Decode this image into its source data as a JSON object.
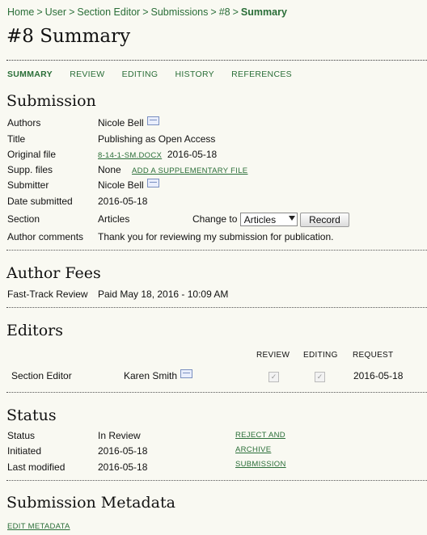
{
  "breadcrumb": {
    "items": [
      "Home",
      "User",
      "Section Editor",
      "Submissions",
      "#8"
    ],
    "current": "Summary",
    "separator": ">"
  },
  "page_title": "#8 Summary",
  "tabs": [
    {
      "label": "SUMMARY",
      "active": true
    },
    {
      "label": "REVIEW",
      "active": false
    },
    {
      "label": "EDITING",
      "active": false
    },
    {
      "label": "HISTORY",
      "active": false
    },
    {
      "label": "REFERENCES",
      "active": false
    }
  ],
  "submission": {
    "heading": "Submission",
    "authors_label": "Authors",
    "authors_value": "Nicole Bell",
    "title_label": "Title",
    "title_value": "Publishing as Open Access",
    "original_file_label": "Original file",
    "original_file_link": "8-14-1-SM.DOCX",
    "original_file_date": "2016-05-18",
    "supp_files_label": "Supp. files",
    "supp_files_value": "None",
    "add_supp_link": "ADD A SUPPLEMENTARY FILE",
    "submitter_label": "Submitter",
    "submitter_value": "Nicole Bell",
    "date_submitted_label": "Date submitted",
    "date_submitted_value": "2016-05-18",
    "section_label": "Section",
    "section_value": "Articles",
    "change_to_label": "Change to",
    "change_to_selected": "Articles",
    "record_button": "Record",
    "author_comments_label": "Author comments",
    "author_comments_value": "Thank you for reviewing my submission for publication."
  },
  "author_fees": {
    "heading": "Author Fees",
    "fast_track_label": "Fast-Track Review",
    "fast_track_value": "Paid May 18, 2016 - 10:09 AM"
  },
  "editors": {
    "heading": "Editors",
    "col_review": "REVIEW",
    "col_editing": "EDITING",
    "col_request": "REQUEST",
    "role": "Section Editor",
    "name": "Karen Smith",
    "request_date": "2016-05-18",
    "review_checked": true,
    "editing_checked": true
  },
  "status": {
    "heading": "Status",
    "status_label": "Status",
    "status_value": "In Review",
    "reject_link": "REJECT AND ARCHIVE SUBMISSION",
    "initiated_label": "Initiated",
    "initiated_value": "2016-05-18",
    "last_modified_label": "Last modified",
    "last_modified_value": "2016-05-18"
  },
  "metadata": {
    "heading": "Submission Metadata",
    "edit_link": "EDIT METADATA"
  },
  "colors": {
    "link": "#2a6e38",
    "background": "#f9f9f2"
  }
}
